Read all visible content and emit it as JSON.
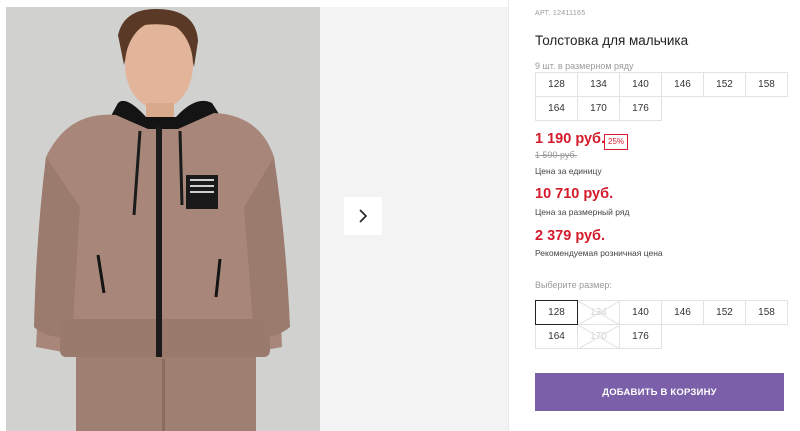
{
  "gallery": {
    "next_icon": "chevron-right-icon"
  },
  "product": {
    "sku": "АРТ. 12411165",
    "title": "Толстовка для мальчика"
  },
  "size_range": {
    "label": "9 шт. в размерном ряду",
    "sizes": [
      "128",
      "134",
      "140",
      "146",
      "152",
      "158",
      "164",
      "170",
      "176"
    ]
  },
  "pricing": {
    "unit_price": "1 190 руб.",
    "discount_badge": "25%",
    "old_price": "1 590 руб.",
    "unit_caption": "Цена за единицу",
    "range_price": "10 710 руб.",
    "range_caption": "Цена за размерный ряд",
    "retail_price": "2 379 руб.",
    "retail_caption": "Рекомендуемая розничная цена",
    "accent_color": "#d41b2c"
  },
  "size_picker": {
    "label": "Выберите размер:",
    "options": [
      {
        "size": "128",
        "state": "selected"
      },
      {
        "size": "134",
        "state": "unavailable"
      },
      {
        "size": "140",
        "state": "available"
      },
      {
        "size": "146",
        "state": "available"
      },
      {
        "size": "152",
        "state": "available"
      },
      {
        "size": "158",
        "state": "available"
      },
      {
        "size": "164",
        "state": "available"
      },
      {
        "size": "170",
        "state": "unavailable"
      },
      {
        "size": "176",
        "state": "available"
      }
    ]
  },
  "cart": {
    "add_label": "ДОБАВИТЬ В КОРЗИНУ",
    "button_color": "#7b5fa8"
  }
}
